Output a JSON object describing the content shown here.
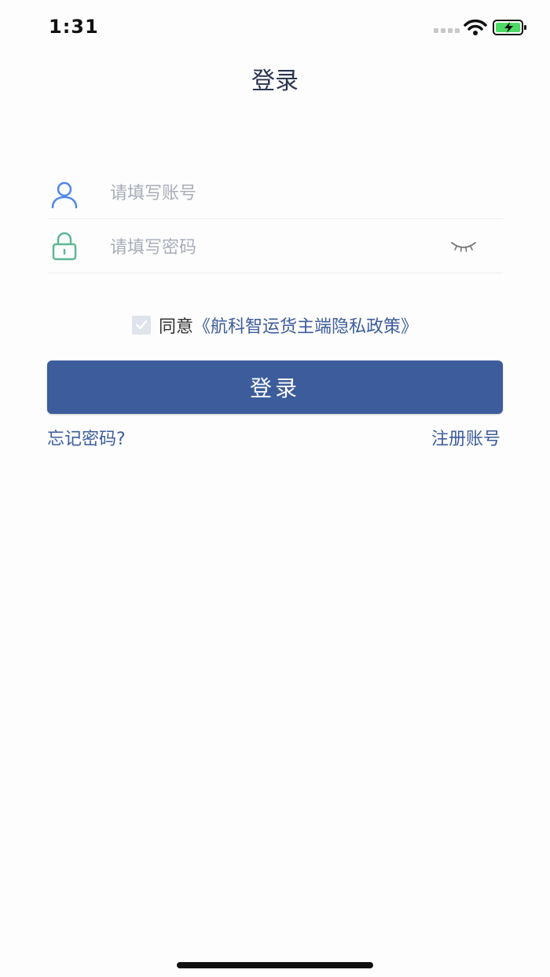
{
  "status_bar": {
    "time": "1:31"
  },
  "nav": {
    "title": "登录"
  },
  "account": {
    "placeholder": "请填写账号"
  },
  "password": {
    "placeholder": "请填写密码"
  },
  "agreement": {
    "checked": true,
    "prefix": "同意",
    "policy_link": "《航科智运货主端隐私政策》"
  },
  "login_button": {
    "label": "登录"
  },
  "links": {
    "forgot": "忘记密码?",
    "register": "注册账号"
  },
  "colors": {
    "primary": "#3d5c9c",
    "account_icon": "#4f86e8",
    "lock_icon": "#5bb894"
  },
  "icons": [
    "person-icon",
    "lock-icon",
    "eye-closed-icon",
    "check-icon",
    "wifi-icon",
    "battery-icon"
  ]
}
